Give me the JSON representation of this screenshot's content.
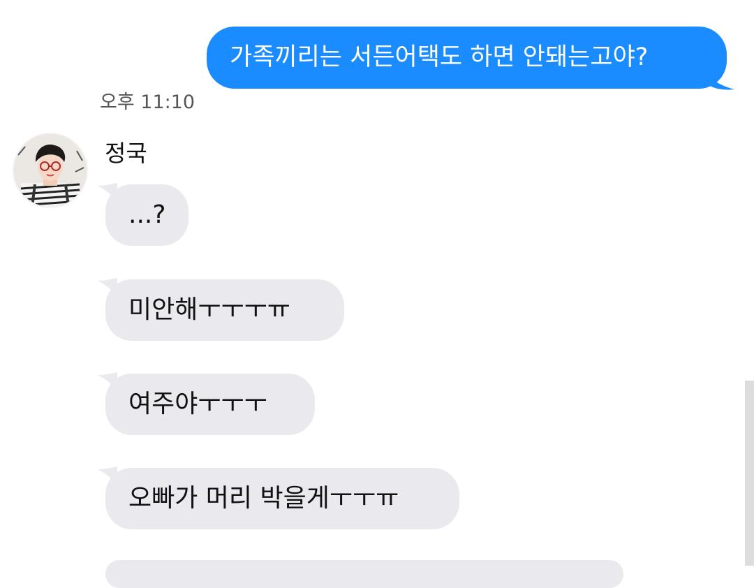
{
  "chat": {
    "outgoing": {
      "text": "가족끼리는 서든어택도 하면 안돼는고야?",
      "color": "#1a8cff"
    },
    "timestamp": "오후 11:10",
    "sender": {
      "name": "정국",
      "avatar_icon": "avatar-photo-icon"
    },
    "incoming": [
      {
        "text": "...?"
      },
      {
        "text": "미안해ㅜㅜㅜㅠ"
      },
      {
        "text": "여주야ㅜㅜㅜ"
      },
      {
        "text": "오빠가 머리 박을게ㅜㅜㅠ"
      }
    ],
    "incoming_color": "#e9e9ee"
  }
}
